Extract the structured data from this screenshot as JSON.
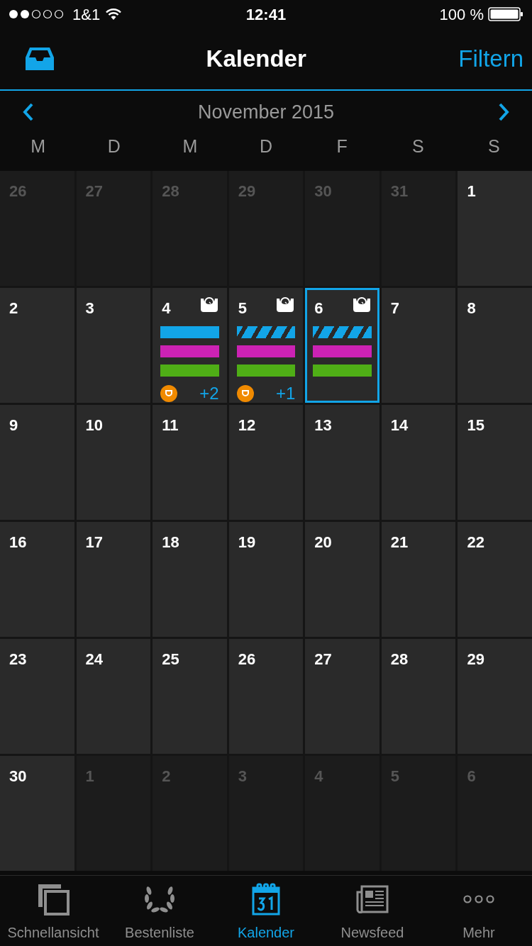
{
  "status_bar": {
    "carrier": "1&1",
    "time": "12:41",
    "battery": "100 %"
  },
  "nav": {
    "title": "Kalender",
    "action": "Filtern"
  },
  "month": {
    "title": "November 2015"
  },
  "weekdays": [
    "M",
    "D",
    "M",
    "D",
    "F",
    "S",
    "S"
  ],
  "cells": [
    {
      "day": "26",
      "muted": true,
      "selected": false
    },
    {
      "day": "27",
      "muted": true,
      "selected": false
    },
    {
      "day": "28",
      "muted": true,
      "selected": false
    },
    {
      "day": "29",
      "muted": true,
      "selected": false
    },
    {
      "day": "30",
      "muted": true,
      "selected": false
    },
    {
      "day": "31",
      "muted": true,
      "selected": false
    },
    {
      "day": "1",
      "muted": false,
      "selected": false
    },
    {
      "day": "2",
      "muted": false,
      "selected": false
    },
    {
      "day": "3",
      "muted": false,
      "selected": false
    },
    {
      "day": "4",
      "muted": false,
      "selected": false,
      "scale_icon": true,
      "events": [
        {
          "color": "#12a5e8",
          "striped": false
        },
        {
          "color": "#cc22b4",
          "striped": false
        },
        {
          "color": "#4fae16",
          "striped": false
        }
      ],
      "badge": true,
      "more": "+2"
    },
    {
      "day": "5",
      "muted": false,
      "selected": false,
      "scale_icon": true,
      "events": [
        {
          "color": "#12a5e8",
          "striped": true
        },
        {
          "color": "#cc22b4",
          "striped": false
        },
        {
          "color": "#4fae16",
          "striped": false
        }
      ],
      "badge": true,
      "more": "+1"
    },
    {
      "day": "6",
      "muted": false,
      "selected": true,
      "scale_icon": true,
      "events": [
        {
          "color": "#12a5e8",
          "striped": true
        },
        {
          "color": "#cc22b4",
          "striped": false
        },
        {
          "color": "#4fae16",
          "striped": false
        }
      ]
    },
    {
      "day": "7",
      "muted": false,
      "selected": false
    },
    {
      "day": "8",
      "muted": false,
      "selected": false
    },
    {
      "day": "9",
      "muted": false,
      "selected": false
    },
    {
      "day": "10",
      "muted": false,
      "selected": false
    },
    {
      "day": "11",
      "muted": false,
      "selected": false
    },
    {
      "day": "12",
      "muted": false,
      "selected": false
    },
    {
      "day": "13",
      "muted": false,
      "selected": false
    },
    {
      "day": "14",
      "muted": false,
      "selected": false
    },
    {
      "day": "15",
      "muted": false,
      "selected": false
    },
    {
      "day": "16",
      "muted": false,
      "selected": false
    },
    {
      "day": "17",
      "muted": false,
      "selected": false
    },
    {
      "day": "18",
      "muted": false,
      "selected": false
    },
    {
      "day": "19",
      "muted": false,
      "selected": false
    },
    {
      "day": "20",
      "muted": false,
      "selected": false
    },
    {
      "day": "21",
      "muted": false,
      "selected": false
    },
    {
      "day": "22",
      "muted": false,
      "selected": false
    },
    {
      "day": "23",
      "muted": false,
      "selected": false
    },
    {
      "day": "24",
      "muted": false,
      "selected": false
    },
    {
      "day": "25",
      "muted": false,
      "selected": false
    },
    {
      "day": "26",
      "muted": false,
      "selected": false
    },
    {
      "day": "27",
      "muted": false,
      "selected": false
    },
    {
      "day": "28",
      "muted": false,
      "selected": false
    },
    {
      "day": "29",
      "muted": false,
      "selected": false
    },
    {
      "day": "30",
      "muted": false,
      "selected": false
    },
    {
      "day": "1",
      "muted": true,
      "selected": false
    },
    {
      "day": "2",
      "muted": true,
      "selected": false
    },
    {
      "day": "3",
      "muted": true,
      "selected": false
    },
    {
      "day": "4",
      "muted": true,
      "selected": false
    },
    {
      "day": "5",
      "muted": true,
      "selected": false
    },
    {
      "day": "6",
      "muted": true,
      "selected": false
    }
  ],
  "tabs": [
    {
      "label": "Schnellansicht",
      "selected": false
    },
    {
      "label": "Bestenliste",
      "selected": false
    },
    {
      "label": "Kalender",
      "selected": true
    },
    {
      "label": "Newsfeed",
      "selected": false
    },
    {
      "label": "Mehr",
      "selected": false
    }
  ]
}
